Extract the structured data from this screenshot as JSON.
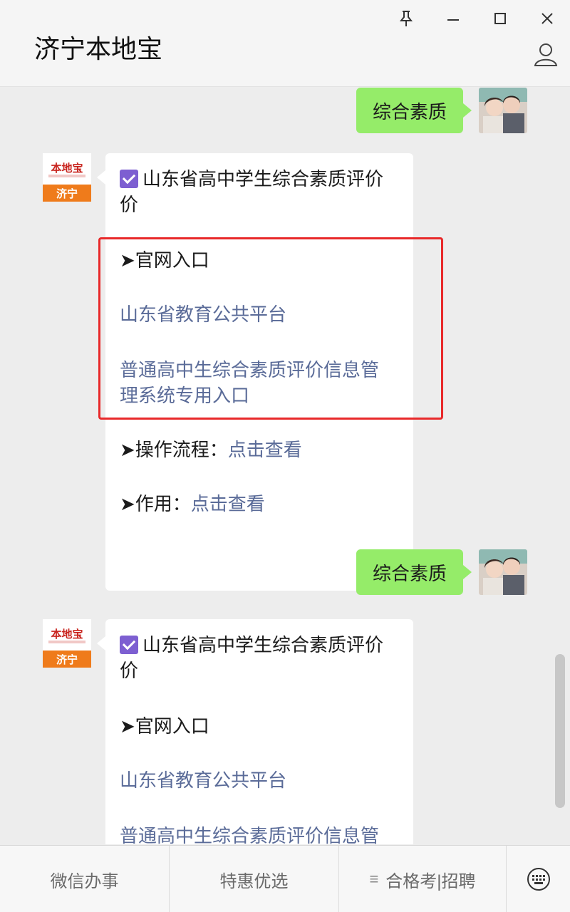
{
  "window": {
    "title": "济宁本地宝"
  },
  "logo": {
    "top_text": "本地宝",
    "bottom_text": "济宁"
  },
  "messages": [
    {
      "type": "outgoing",
      "text": "综合素质"
    },
    {
      "type": "incoming",
      "heading": "山东省高中学生综合素质评价",
      "heading_cont": "价",
      "official_label": "➤官网入口",
      "link1": "山东省教育公共平台",
      "link2_line1": "普通高中生综合素质评价信息管",
      "link2_line2": "理系统专用入口",
      "process_label": "➤操作流程：",
      "process_link": "点击查看",
      "effect_label": "➤作用：",
      "effect_link": "点击查看"
    },
    {
      "type": "outgoing",
      "text": "综合素质"
    },
    {
      "type": "incoming",
      "heading": "山东省高中学生综合素质评价",
      "heading_cont": "价",
      "official_label": "➤官网入口",
      "link1": "山东省教育公共平台",
      "link2_line1": "普通高中生综合素质评价信息管"
    }
  ],
  "bottom_menu": {
    "items": [
      "微信办事",
      "特惠优选",
      "合格考|招聘"
    ]
  },
  "colors": {
    "outgoing_bubble": "#95ec69",
    "link": "#5a6b98",
    "highlight_box": "#e8292a",
    "checkbox": "#7d5fd1"
  }
}
